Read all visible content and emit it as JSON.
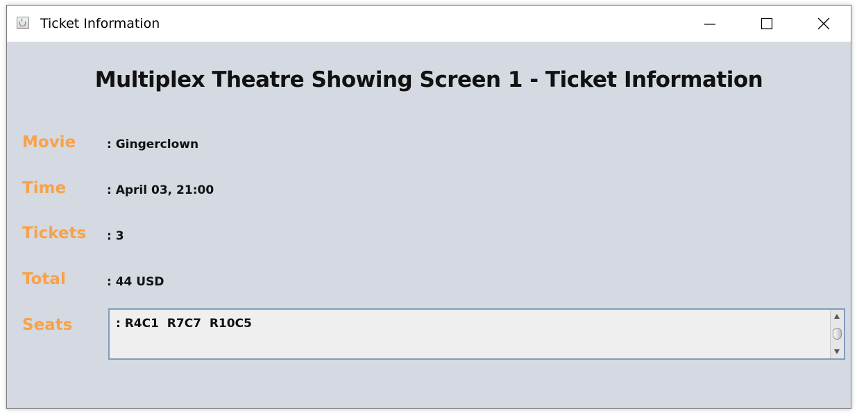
{
  "window": {
    "title": "Ticket Information",
    "icon": "java-cup-icon",
    "controls": {
      "minimize": "minimize-icon",
      "maximize": "maximize-icon",
      "close": "close-icon"
    }
  },
  "heading": "Multiplex Theatre Showing Screen 1 - Ticket Information",
  "fields": {
    "movie": {
      "label": "Movie",
      "value": ": Gingerclown"
    },
    "time": {
      "label": "Time",
      "value": ": April 03, 21:00"
    },
    "tickets": {
      "label": "Tickets",
      "value": ": 3"
    },
    "total": {
      "label": "Total",
      "value": ": 44 USD"
    },
    "seats": {
      "label": "Seats",
      "value": ": R4C1  R7C7  R10C5"
    }
  },
  "colors": {
    "label": "#f7a24a",
    "background": "#d5d9e1",
    "text": "#111111",
    "seats_border": "#7f9cc0"
  }
}
